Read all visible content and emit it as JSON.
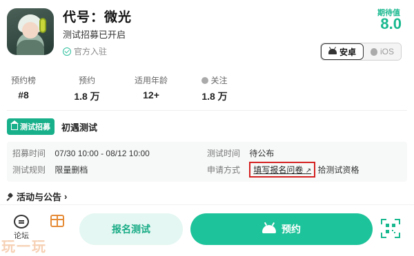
{
  "game": {
    "title": "代号：微光",
    "status": "测试招募已开启",
    "official": "官方入驻",
    "score_label": "期待值",
    "score": "8.0"
  },
  "platforms": {
    "android": "安卓",
    "ios": "iOS"
  },
  "stats": [
    {
      "label": "预约榜",
      "value": "#8"
    },
    {
      "label": "预约",
      "value": "1.8 万"
    },
    {
      "label": "适用年龄",
      "value": "12+"
    },
    {
      "label": "关注",
      "value": "1.8 万"
    }
  ],
  "test": {
    "badge": "测试招募",
    "name": "初遇测试",
    "recruit_time_label": "招募时间",
    "recruit_time": "07/30 10:00 - 08/12 10:00",
    "test_time_label": "测试时间",
    "test_time": "待公布",
    "rules_label": "测试规则",
    "rules": "限量删档",
    "apply_label": "申请方式",
    "apply_link": "填写报名问卷",
    "apply_suffix": "拾测试资格"
  },
  "notice": {
    "label": "活动与公告",
    "chevron": "›"
  },
  "bottom": {
    "forum": "论坛",
    "signup": "报名测试",
    "reserve": "预约"
  },
  "watermark": "玩一玩",
  "colors": {
    "accent": "#1dc39a",
    "highlight_border": "#d42020"
  }
}
